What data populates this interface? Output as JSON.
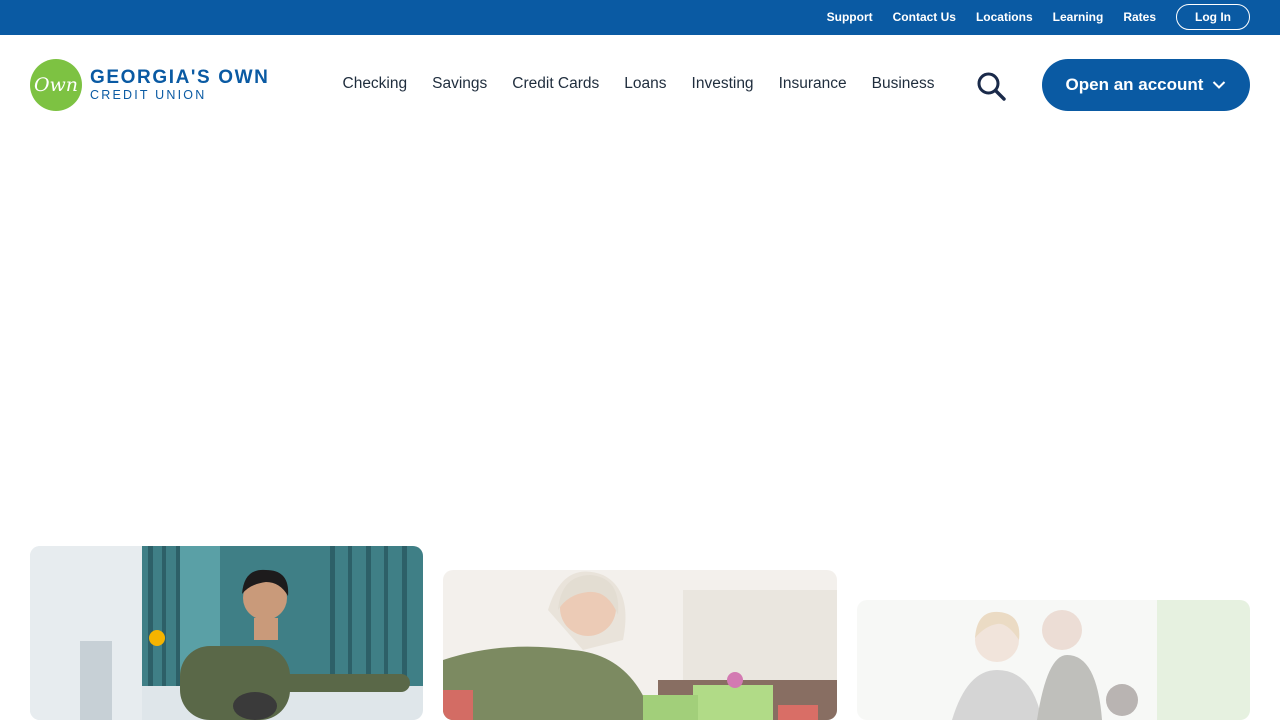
{
  "utility": {
    "links": [
      "Support",
      "Contact Us",
      "Locations",
      "Learning",
      "Rates"
    ],
    "login_label": "Log In"
  },
  "brand": {
    "logo_mark": "Own",
    "name_line1": "GEORGIA'S OWN",
    "name_line2": "CREDIT UNION"
  },
  "nav": {
    "items": [
      "Checking",
      "Savings",
      "Credit Cards",
      "Loans",
      "Investing",
      "Insurance",
      "Business"
    ]
  },
  "icons": {
    "search": "search-icon",
    "chevron": "chevron-down-icon"
  },
  "cta": {
    "open_account_label": "Open an account"
  },
  "colors": {
    "primary_blue": "#0a5aa3",
    "brand_green": "#7dc242",
    "nav_text": "#1f2d3d",
    "background": "#ffffff"
  },
  "cards": [
    {
      "image": "man-playing-ping-pong-photo"
    },
    {
      "image": "woman-wrapping-gifts-photo"
    },
    {
      "image": "family-smiling-photo"
    }
  ]
}
